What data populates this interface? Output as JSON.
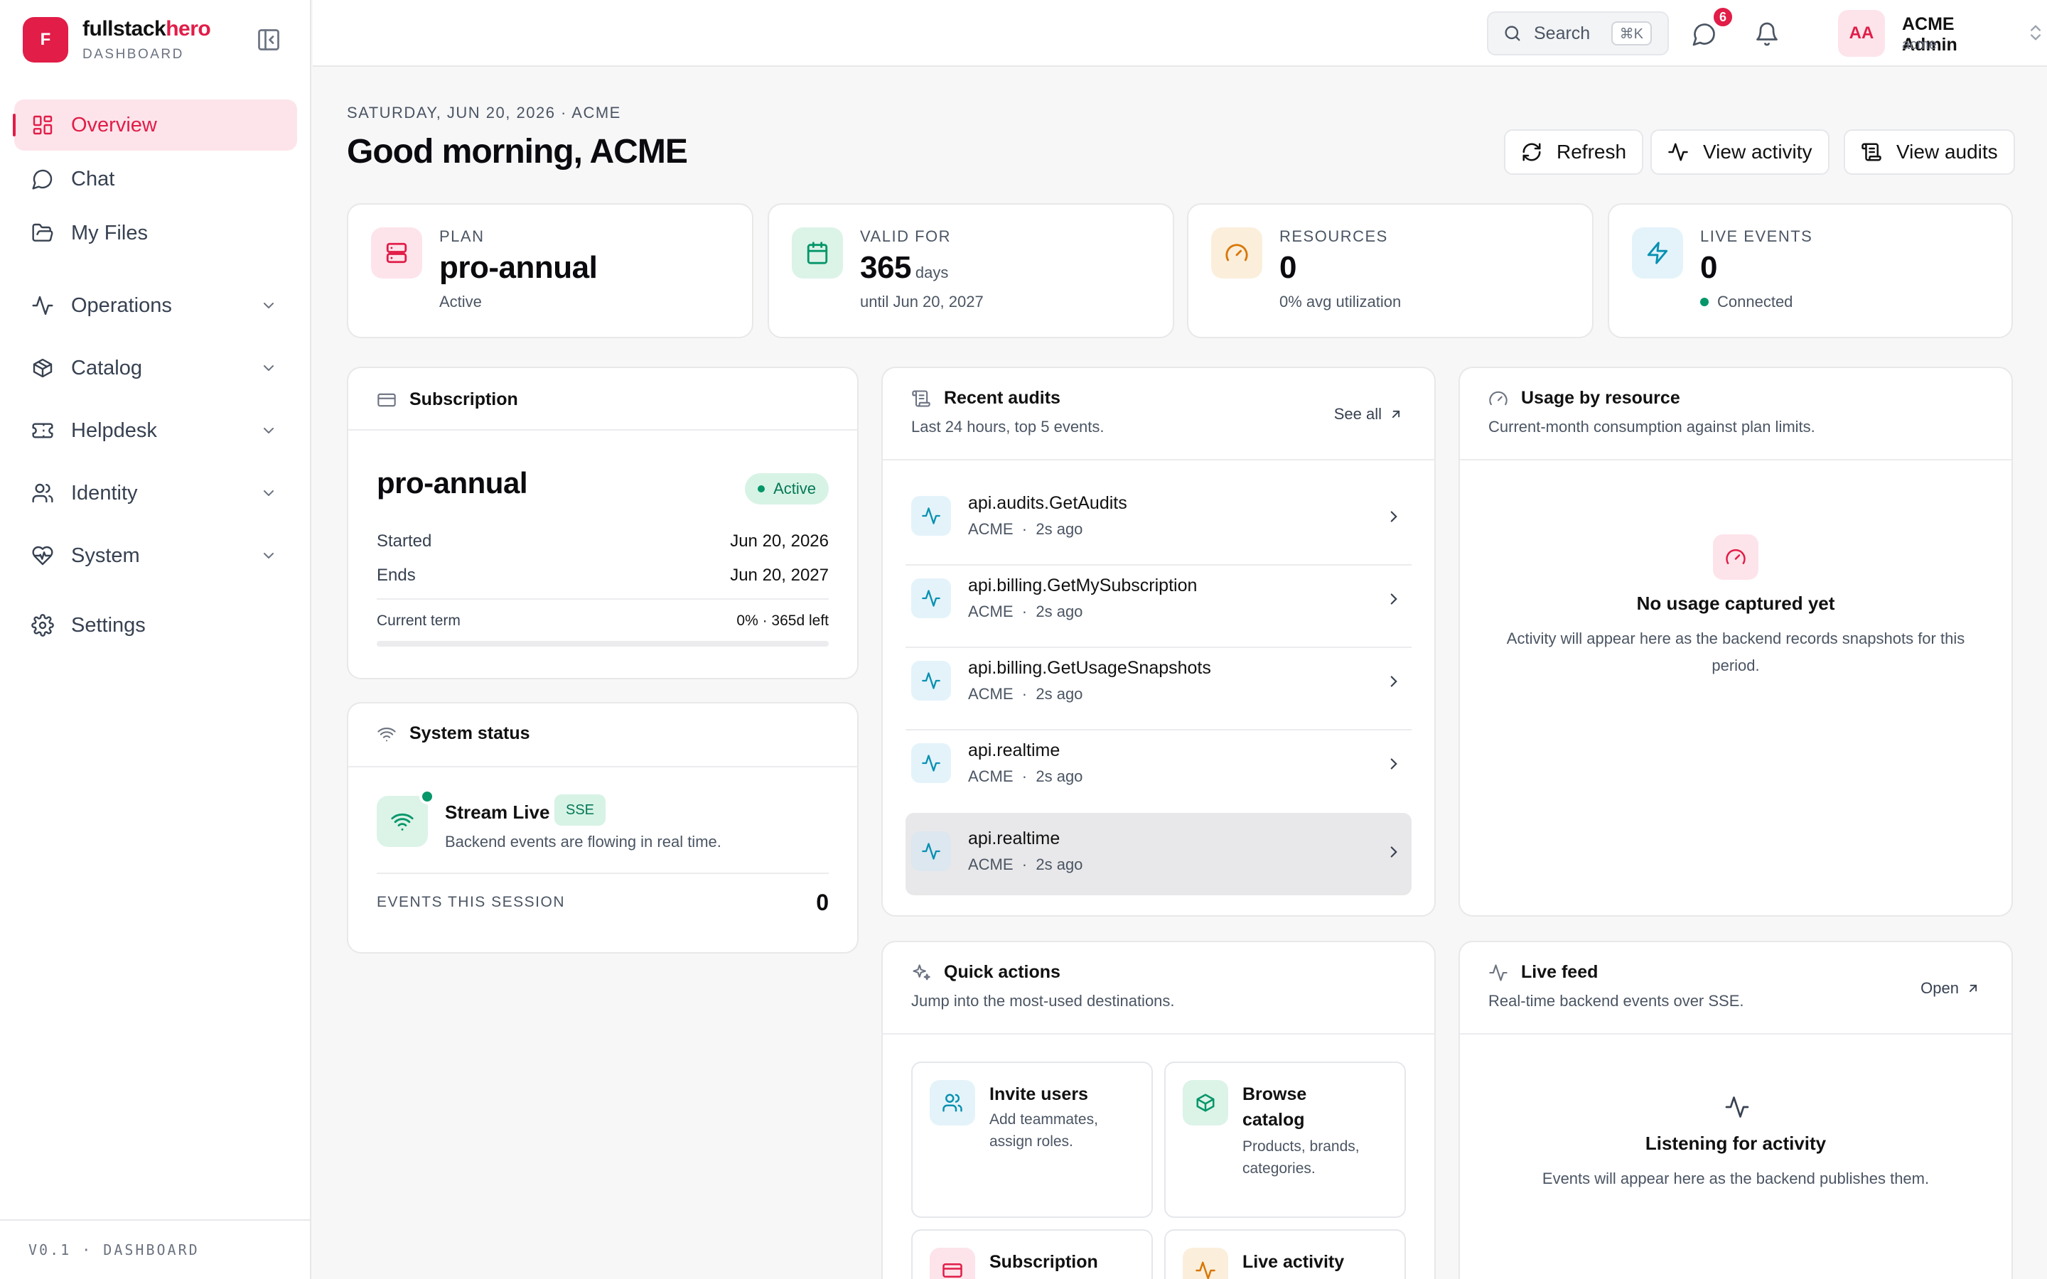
{
  "brand": {
    "name_main": "fullstack",
    "name_accent": "hero",
    "subtitle": "DASHBOARD",
    "logo_letter": "F"
  },
  "nav": {
    "overview": "Overview",
    "chat": "Chat",
    "files": "My Files",
    "operations": "Operations",
    "catalog": "Catalog",
    "helpdesk": "Helpdesk",
    "identity": "Identity",
    "system": "System",
    "settings": "Settings"
  },
  "footer": {
    "version": "V0.1 · DASHBOARD"
  },
  "topbar": {
    "search_label": "Search",
    "search_shortcut": "⌘K",
    "messages_badge": "6",
    "user_initials": "AA",
    "user_name": "ACME Admin",
    "user_tenant": "acme"
  },
  "header": {
    "eyebrow": "SATURDAY, JUN 20, 2026 · ACME",
    "greeting": "Good morning, ACME",
    "refresh": "Refresh",
    "view_activity": "View activity",
    "view_audits": "View audits"
  },
  "stats": {
    "plan": {
      "label": "PLAN",
      "value": "pro-annual",
      "sub": "Active"
    },
    "valid": {
      "label": "VALID FOR",
      "value": "365",
      "unit": "days",
      "sub": "until Jun 20, 2027"
    },
    "resources": {
      "label": "RESOURCES",
      "value": "0",
      "sub": "0% avg utilization"
    },
    "live": {
      "label": "LIVE EVENTS",
      "value": "0",
      "sub": "Connected"
    }
  },
  "subscription": {
    "title": "Subscription",
    "plan": "pro-annual",
    "status": "Active",
    "started_label": "Started",
    "started_value": "Jun 20, 2026",
    "ends_label": "Ends",
    "ends_value": "Jun 20, 2027",
    "term_label": "Current term",
    "term_value": "0% · 365d left",
    "term_progress": 0
  },
  "system_status": {
    "title": "System status",
    "stream_title": "Stream Live",
    "stream_tag": "SSE",
    "stream_sub": "Backend events are flowing in real time.",
    "events_label": "EVENTS THIS SESSION",
    "events_value": "0"
  },
  "audits": {
    "title": "Recent audits",
    "subtitle": "Last 24 hours, top 5 events.",
    "see_all": "See all",
    "items": [
      {
        "name": "api.audits.GetAudits",
        "tenant": "ACME",
        "sep": "·",
        "time": "2s ago"
      },
      {
        "name": "api.billing.GetMySubscription",
        "tenant": "ACME",
        "sep": "·",
        "time": "2s ago"
      },
      {
        "name": "api.billing.GetUsageSnapshots",
        "tenant": "ACME",
        "sep": "·",
        "time": "2s ago"
      },
      {
        "name": "api.realtime",
        "tenant": "ACME",
        "sep": "·",
        "time": "2s ago"
      },
      {
        "name": "api.realtime",
        "tenant": "ACME",
        "sep": "·",
        "time": "2s ago"
      }
    ]
  },
  "usage": {
    "title": "Usage by resource",
    "subtitle": "Current-month consumption against plan limits.",
    "empty_title": "No usage captured yet",
    "empty_text": "Activity will appear here as the backend records snapshots for this period."
  },
  "quick_actions": {
    "title": "Quick actions",
    "subtitle": "Jump into the most-used destinations.",
    "invite_title": "Invite users",
    "invite_desc": "Add teammates, assign roles.",
    "catalog_title": "Browse catalog",
    "catalog_desc": "Products, brands, categories.",
    "subscription_title": "Subscription",
    "activity_title": "Live activity"
  },
  "live_feed": {
    "title": "Live feed",
    "subtitle": "Real-time backend events over SSE.",
    "open": "Open",
    "empty_title": "Listening for activity",
    "empty_text": "Events will appear here as the backend publishes them."
  },
  "colors": {
    "accent": "#e11d48",
    "success": "#059669",
    "info": "#0891b2",
    "warning": "#d97706"
  }
}
